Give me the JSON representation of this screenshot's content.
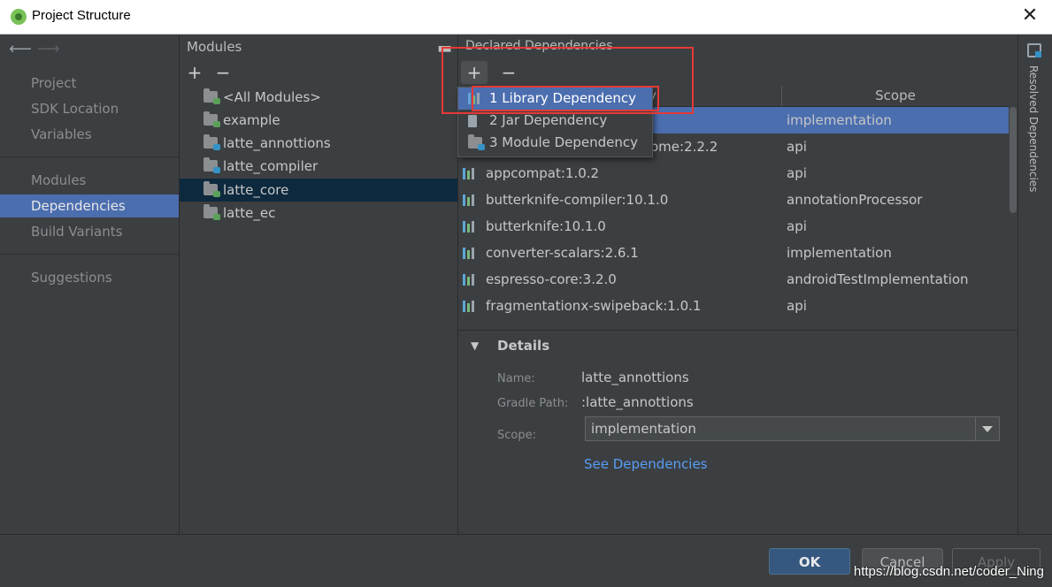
{
  "window": {
    "title": "Project Structure"
  },
  "nav": {
    "items": [
      {
        "label": "Project"
      },
      {
        "label": "SDK Location"
      },
      {
        "label": "Variables"
      },
      {
        "label": "Modules"
      },
      {
        "label": "Dependencies"
      },
      {
        "label": "Build Variants"
      },
      {
        "label": "Suggestions"
      }
    ],
    "selected": "Dependencies"
  },
  "modules": {
    "header": "Modules",
    "add": "+",
    "remove": "−",
    "items": [
      {
        "label": "<All Modules>"
      },
      {
        "label": "example"
      },
      {
        "label": "latte_annottions"
      },
      {
        "label": "latte_compiler"
      },
      {
        "label": "latte_core"
      },
      {
        "label": "latte_ec"
      }
    ],
    "selected": "latte_core"
  },
  "dependencies": {
    "header": "Declared Dependencies",
    "add": "+",
    "remove": "−",
    "columns": {
      "name_partial": "y",
      "scope": "Scope"
    },
    "rows": [
      {
        "name": "",
        "scope": "implementation"
      },
      {
        "name": "ome:2.2.2",
        "scope": "api"
      },
      {
        "name": "appcompat:1.0.2",
        "scope": "api"
      },
      {
        "name": "butterknife-compiler:10.1.0",
        "scope": "annotationProcessor"
      },
      {
        "name": "butterknife:10.1.0",
        "scope": "api"
      },
      {
        "name": "converter-scalars:2.6.1",
        "scope": "implementation"
      },
      {
        "name": "espresso-core:3.2.0",
        "scope": "androidTestImplementation"
      },
      {
        "name": "fragmentationx-swipeback:1.0.1",
        "scope": "api"
      }
    ]
  },
  "popup": {
    "items": [
      {
        "label": "1  Library Dependency"
      },
      {
        "label": "2  Jar Dependency"
      },
      {
        "label": "3  Module Dependency"
      }
    ]
  },
  "details": {
    "header": "Details",
    "name_label": "Name:",
    "name_value": "latte_annottions",
    "gradle_label": "Gradle Path:",
    "gradle_value": ":latte_annottions",
    "scope_label": "Scope:",
    "scope_value": "implementation",
    "see_deps": "See Dependencies"
  },
  "right_strip": {
    "label": "Resolved Dependencies"
  },
  "buttons": {
    "ok": "OK",
    "cancel": "Cancel",
    "apply": "Apply"
  },
  "watermark": "https://blog.csdn.net/coder_Ning",
  "colors": {
    "selection": "#4b6eaf",
    "accent_link": "#589df6",
    "highlight_box": "#e53935"
  }
}
